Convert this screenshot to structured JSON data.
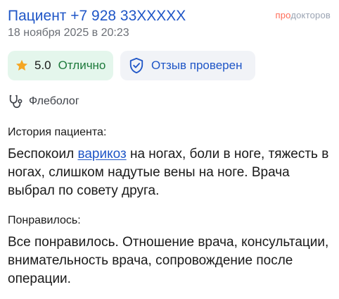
{
  "review": {
    "author": "Пациент +7 928 33XXXXX",
    "date": "18 ноября 2025 в 20:23",
    "brand_part1": "про",
    "brand_part2": "докторов",
    "rating_value": "5.0",
    "rating_label": "Отлично",
    "verified_label": "Отзыв проверен",
    "specialty": "Флеболог",
    "history": {
      "title": "История пациента:",
      "text_before": "Беспокоил ",
      "link": "варикоз",
      "text_after": " на ногах, боли в ноге, тяжесть в ногах, слишком надутые вены на ноге. Врача выбрал по совету друга."
    },
    "liked": {
      "title": "Понравилось:",
      "text": "Все понравилось. Отношение врача, консультации, внимательность врача, сопровождение после операции."
    }
  },
  "colors": {
    "accent": "#1f56c7",
    "rating_bg": "#e4f6ec",
    "rating_text": "#1d7a3b",
    "verified_bg": "#f1f3f7",
    "brand_accent": "#ff6b57",
    "star": "#f5a623"
  },
  "icons": [
    "star-icon",
    "shield-check-icon",
    "stethoscope-icon"
  ]
}
